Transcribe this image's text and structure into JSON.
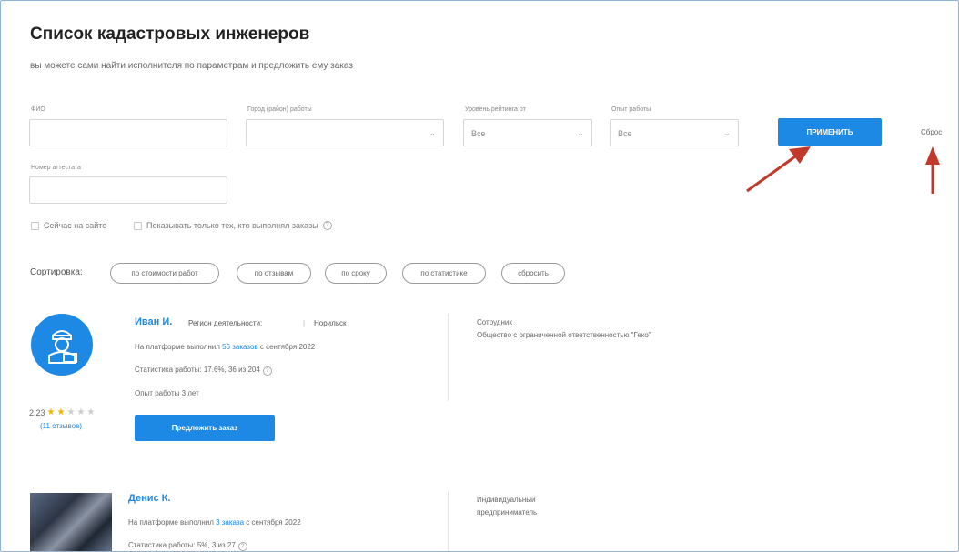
{
  "page": {
    "title": "Список кадастровых инженеров",
    "subtitle": "вы можете сами найти исполнителя по параметрам и предложить ему заказ"
  },
  "filters": {
    "fio_label": "ФИО",
    "city_label": "Город (район) работы",
    "rating_label": "Уровень рейтинга от",
    "exp_label": "Опыт работы",
    "cert_label": "Номер аттестата",
    "rating_value": "Все",
    "exp_value": "Все",
    "apply_label": "ПРИМЕНИТЬ",
    "reset_label": "Сброс",
    "check_online": "Сейчас на сайте",
    "check_completed": "Показывать только тех, кто выполнял заказы"
  },
  "sort": {
    "label": "Сортировка:",
    "options": [
      "по стоимости работ",
      "по отзывам",
      "по сроку",
      "по статистике",
      "сбросить"
    ]
  },
  "engineers": [
    {
      "name": "Иван И.",
      "region_label": "Регион деятельности:",
      "region_value": "Норильск",
      "platform_text": "На платформе выполнил ",
      "platform_link": "56 заказов",
      "platform_tail": " с сентября 2022",
      "stats": "Статистика работы: 17.6%, 36 из 204",
      "experience": "Опыт работы 3 лет",
      "rating": "2,23",
      "stars_filled": 2,
      "reviews": "(11 отзывов)",
      "offer_label": "Предложить заказ",
      "employer_label": "Сотрудник",
      "employer_value": "Общество с ограниченной ответственностью \"Геко\""
    },
    {
      "name": "Денис К.",
      "platform_text": "На платформе выполнил ",
      "platform_link": "3 заказа",
      "platform_tail": " с сентября 2022",
      "stats": "Статистика работы: 5%, 3 из 27",
      "side_line1": "Индивидуальный",
      "side_line2": "предприниматель"
    }
  ],
  "colors": {
    "accent": "#1e88e5",
    "arrow": "#c0392b"
  }
}
